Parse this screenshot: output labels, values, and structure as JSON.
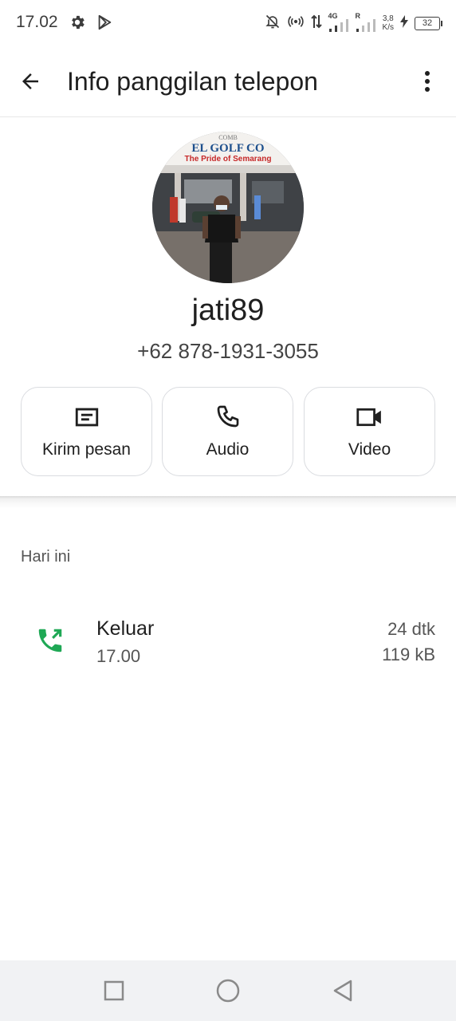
{
  "status_bar": {
    "time": "17.02",
    "icons": [
      "settings-gear-icon",
      "play-store-icon",
      "mute-notification-icon",
      "hotspot-icon",
      "data-arrows-icon",
      "signal-4g-icon",
      "signal-roaming-icon",
      "charging-icon"
    ],
    "net_4g": "4G",
    "roaming": "R",
    "speed_value": "3,8",
    "speed_unit": "K/s",
    "battery": "32"
  },
  "app_bar": {
    "title": "Info panggilan telepon",
    "back_icon": "arrow-back-icon",
    "more_icon": "more-vert-icon"
  },
  "contact": {
    "name": "jati89",
    "phone": "+62 878-1931-3055",
    "avatar": {
      "sign_text_line1": "EL GOLF CO",
      "sign_text_line2": "The Pride of Semarang",
      "sign_top": "COMB"
    }
  },
  "actions": [
    {
      "label": "Kirim pesan",
      "icon": "message-icon"
    },
    {
      "label": "Audio",
      "icon": "phone-icon"
    },
    {
      "label": "Video",
      "icon": "videocam-icon"
    }
  ],
  "history": {
    "heading": "Hari ini",
    "calls": [
      {
        "type": "Keluar",
        "time": "17.00",
        "duration": "24 dtk",
        "size": "119 kB",
        "icon": "outgoing-call-icon",
        "icon_color": "#1fa855"
      }
    ]
  },
  "nav_bar": {
    "icons": [
      "recents-square-icon",
      "home-circle-icon",
      "back-triangle-icon"
    ]
  }
}
